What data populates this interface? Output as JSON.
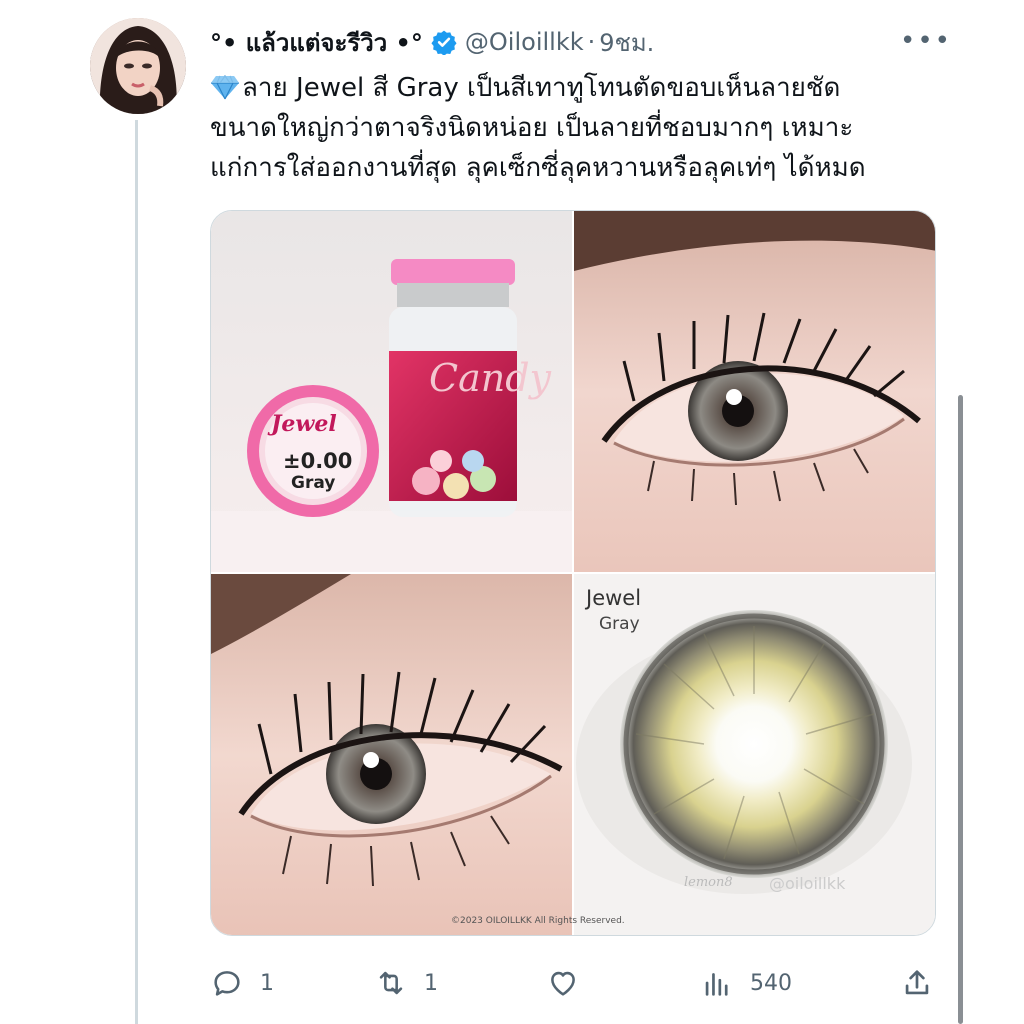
{
  "tweet": {
    "display_name": "°• แล้วแต่จะรีวิว •°",
    "handle": "@Oiloillkk",
    "separator": "·",
    "time": "9ชม.",
    "text_lines": [
      "ลาย Jewel สี Gray เป็นสีเทาทูโทนตัดขอบเห็นลายชัด",
      "ขนาดใหญ่กว่าตาจริงนิดหน่อย เป็นลายที่ชอบมากๆ เหมาะ",
      "แก่การใส่ออกงานที่สุด ลุคเซ็กซี่ลุคหวานหรือลุคเท่ๆ ได้หมด"
    ],
    "leading_emoji": "gem-icon"
  },
  "media": {
    "bottle_brand": "Candy",
    "case_brand": "Jewel",
    "case_power": "±0.00",
    "case_color": "Gray",
    "lens_title": "Jewel",
    "lens_color": "Gray",
    "watermark_app": "lemon8",
    "watermark_user": "@oiloillkk",
    "copyright": "©2023 OILOILLKK All Rights Reserved."
  },
  "actions": {
    "replies": "1",
    "retweets": "1",
    "views": "540"
  },
  "colors": {
    "verified": "#1d9bf0",
    "secondary_text": "#536471",
    "case_pink": "#f06aa8",
    "bottle_red": "#c2184b"
  }
}
